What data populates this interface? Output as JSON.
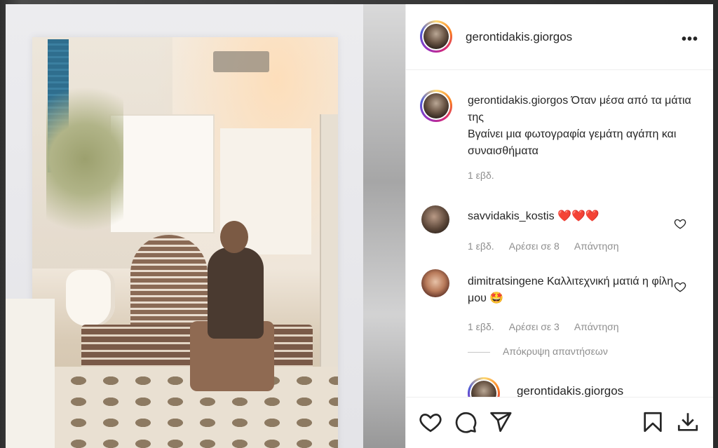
{
  "post": {
    "username": "gerontidakis.giorgos",
    "more_label": "•••"
  },
  "caption": {
    "username": "gerontidakis.giorgos",
    "line1": " Όταν μέσα από τα μάτια της",
    "line2": "Βγαίνει μια φωτογραφία γεμάτη αγάπη και συναισθήματα",
    "time": "1 εβδ."
  },
  "comments": [
    {
      "username": "savvidakis_kostis",
      "text": " ❤️❤️❤️",
      "time": "1 εβδ.",
      "likes": "Αρέσει σε 8",
      "reply": "Απάντηση"
    },
    {
      "username": "dimitratsingene",
      "text": " Καλλιτεχνική ματιά η φίλη μου 🤩",
      "time": "1 εβδ.",
      "likes": "Αρέσει σε 3",
      "reply": "Απάντηση"
    }
  ],
  "hide_replies": "Απόκρυψη απαντήσεων",
  "reply": {
    "username": "gerontidakis.giorgos"
  },
  "icons": {
    "like": "heart-icon",
    "comment": "comment-icon",
    "share": "share-icon",
    "save": "bookmark-icon",
    "download": "download-icon"
  },
  "colors": {
    "heart": "#e0192f",
    "meta": "#8e8e8e",
    "text": "#262626"
  }
}
